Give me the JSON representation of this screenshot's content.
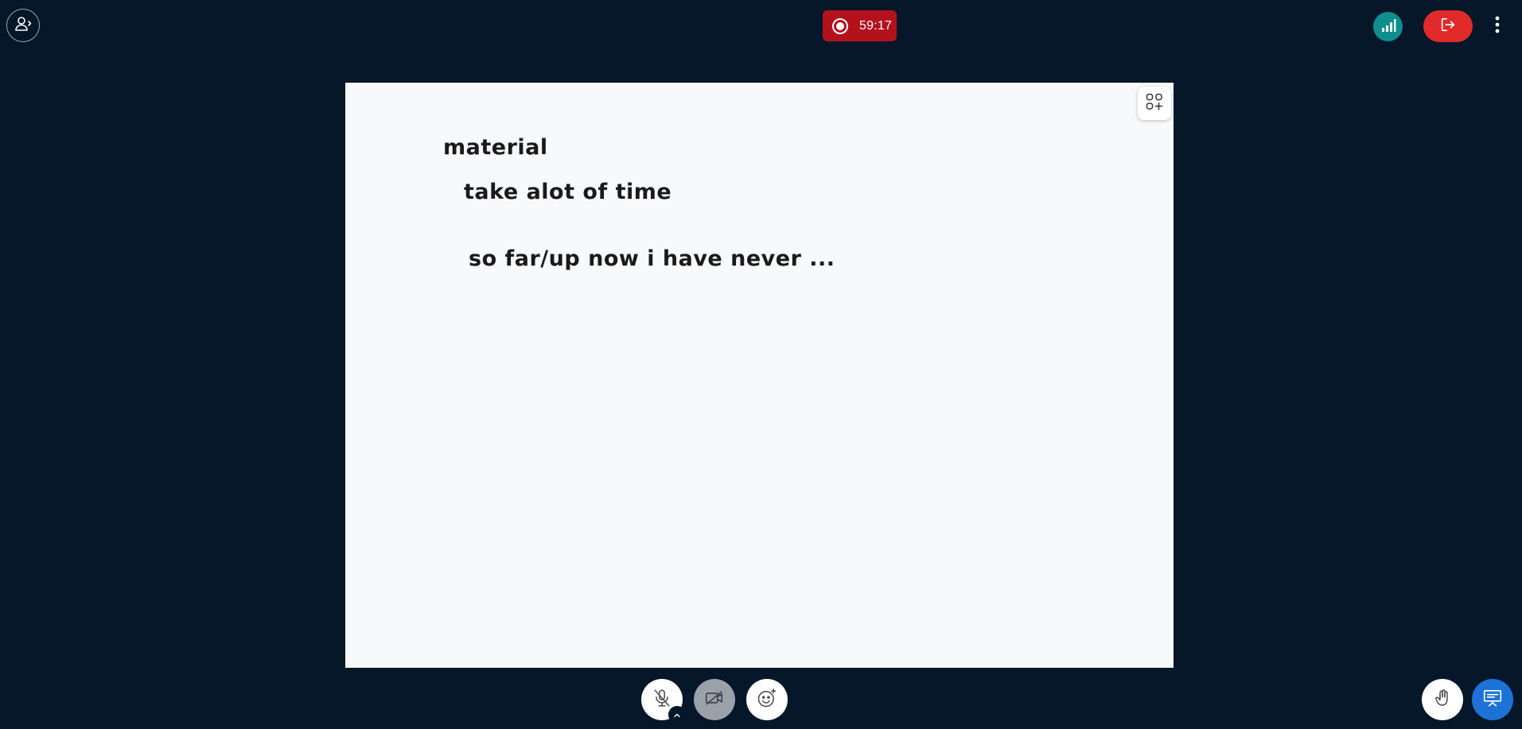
{
  "recording": {
    "timer": "59:17"
  },
  "whiteboard": {
    "lines": [
      "material",
      "take alot of time",
      "so far/up now i have never ..."
    ]
  },
  "icons": {
    "user_list": "user-list-toggle-icon",
    "record": "record-icon",
    "connection": "connection-status-icon",
    "leave": "leave-meeting-icon",
    "more": "more-options-icon",
    "tool": "whiteboard-tools-icon",
    "mic": "microphone-muted-icon",
    "camera": "camera-off-icon",
    "reactions": "reactions-icon",
    "hand": "raise-hand-icon",
    "presentation": "presentation-icon"
  },
  "colors": {
    "background": "#06172a",
    "recording": "#b3121d",
    "leave": "#e12a2a",
    "connection": "#0e8e8e",
    "present": "#1d72d8"
  }
}
